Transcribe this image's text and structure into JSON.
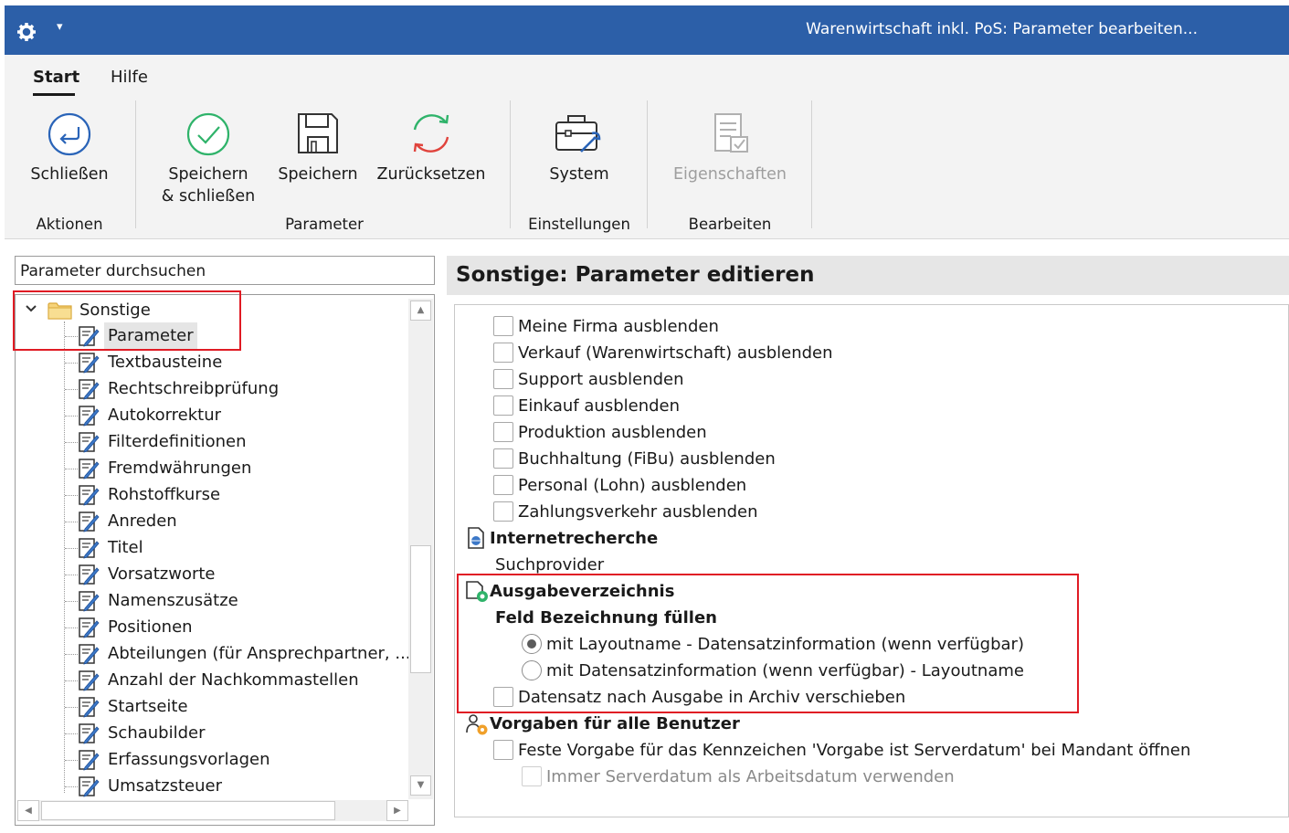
{
  "window": {
    "title": "Warenwirtschaft inkl. PoS: Parameter bearbeiten..."
  },
  "ribbon": {
    "tabs": [
      "Start",
      "Hilfe"
    ],
    "active_tab": "Start",
    "buttons": {
      "close": "Schließen",
      "save_close_1": "Speichern",
      "save_close_2": "& schließen",
      "save": "Speichern",
      "reset": "Zurücksetzen",
      "system": "System",
      "properties": "Eigenschaften"
    },
    "groups": {
      "actions": "Aktionen",
      "parameter": "Parameter",
      "settings": "Einstellungen",
      "edit": "Bearbeiten"
    }
  },
  "left": {
    "search_placeholder": "Parameter durchsuchen",
    "root": "Sonstige",
    "items": [
      "Parameter",
      "Textbausteine",
      "Rechtschreibprüfung",
      "Autokorrektur",
      "Filterdefinitionen",
      "Fremdwährungen",
      "Rohstoffkurse",
      "Anreden",
      "Titel",
      "Vorsatzworte",
      "Namenszusätze",
      "Positionen",
      "Abteilungen (für Ansprechpartner, ...)",
      "Anzahl der Nachkommastellen",
      "Startseite",
      "Schaubilder",
      "Erfassungsvorlagen",
      "Umsatzsteuer"
    ],
    "selected": "Parameter"
  },
  "right": {
    "title": "Sonstige: Parameter editieren",
    "checkboxes_top": [
      "Meine Firma ausblenden",
      "Verkauf (Warenwirtschaft) ausblenden",
      "Support ausblenden",
      "Einkauf ausblenden",
      "Produktion ausblenden",
      "Buchhaltung (FiBu) ausblenden",
      "Personal (Lohn) ausblenden",
      "Zahlungsverkehr ausblenden"
    ],
    "section_internet": "Internetrecherche",
    "suchprovider": "Suchprovider",
    "section_ausgabe": "Ausgabeverzeichnis",
    "feld_label": "Feld Bezeichnung füllen",
    "radio_1": "mit Layoutname - Datensatzinformation (wenn verfügbar)",
    "radio_2": "mit Datensatzinformation (wenn verfügbar) - Layoutname",
    "radio_selected": 1,
    "archive_checkbox": "Datensatz nach Ausgabe in Archiv verschieben",
    "section_vorgaben": "Vorgaben für alle Benutzer",
    "server_checkbox": "Feste Vorgabe für das Kennzeichen 'Vorgabe ist Serverdatum' bei Mandant öffnen",
    "server_sub_checkbox": "Immer Serverdatum als Arbeitsdatum verwenden"
  },
  "colors": {
    "titlebar": "#2c5fa8",
    "highlight_box": "#e01b24",
    "check_green": "#2fb36a",
    "reset_red": "#e0433c",
    "folder": "#f2c14e"
  },
  "icons": [
    "gear-icon",
    "back-arrow-icon",
    "check-circle-icon",
    "floppy-disk-icon",
    "refresh-icon",
    "toolbox-icon",
    "properties-icon",
    "folder-icon",
    "edit-note-icon",
    "globe-doc-icon",
    "output-folder-icon",
    "user-gear-icon"
  ]
}
